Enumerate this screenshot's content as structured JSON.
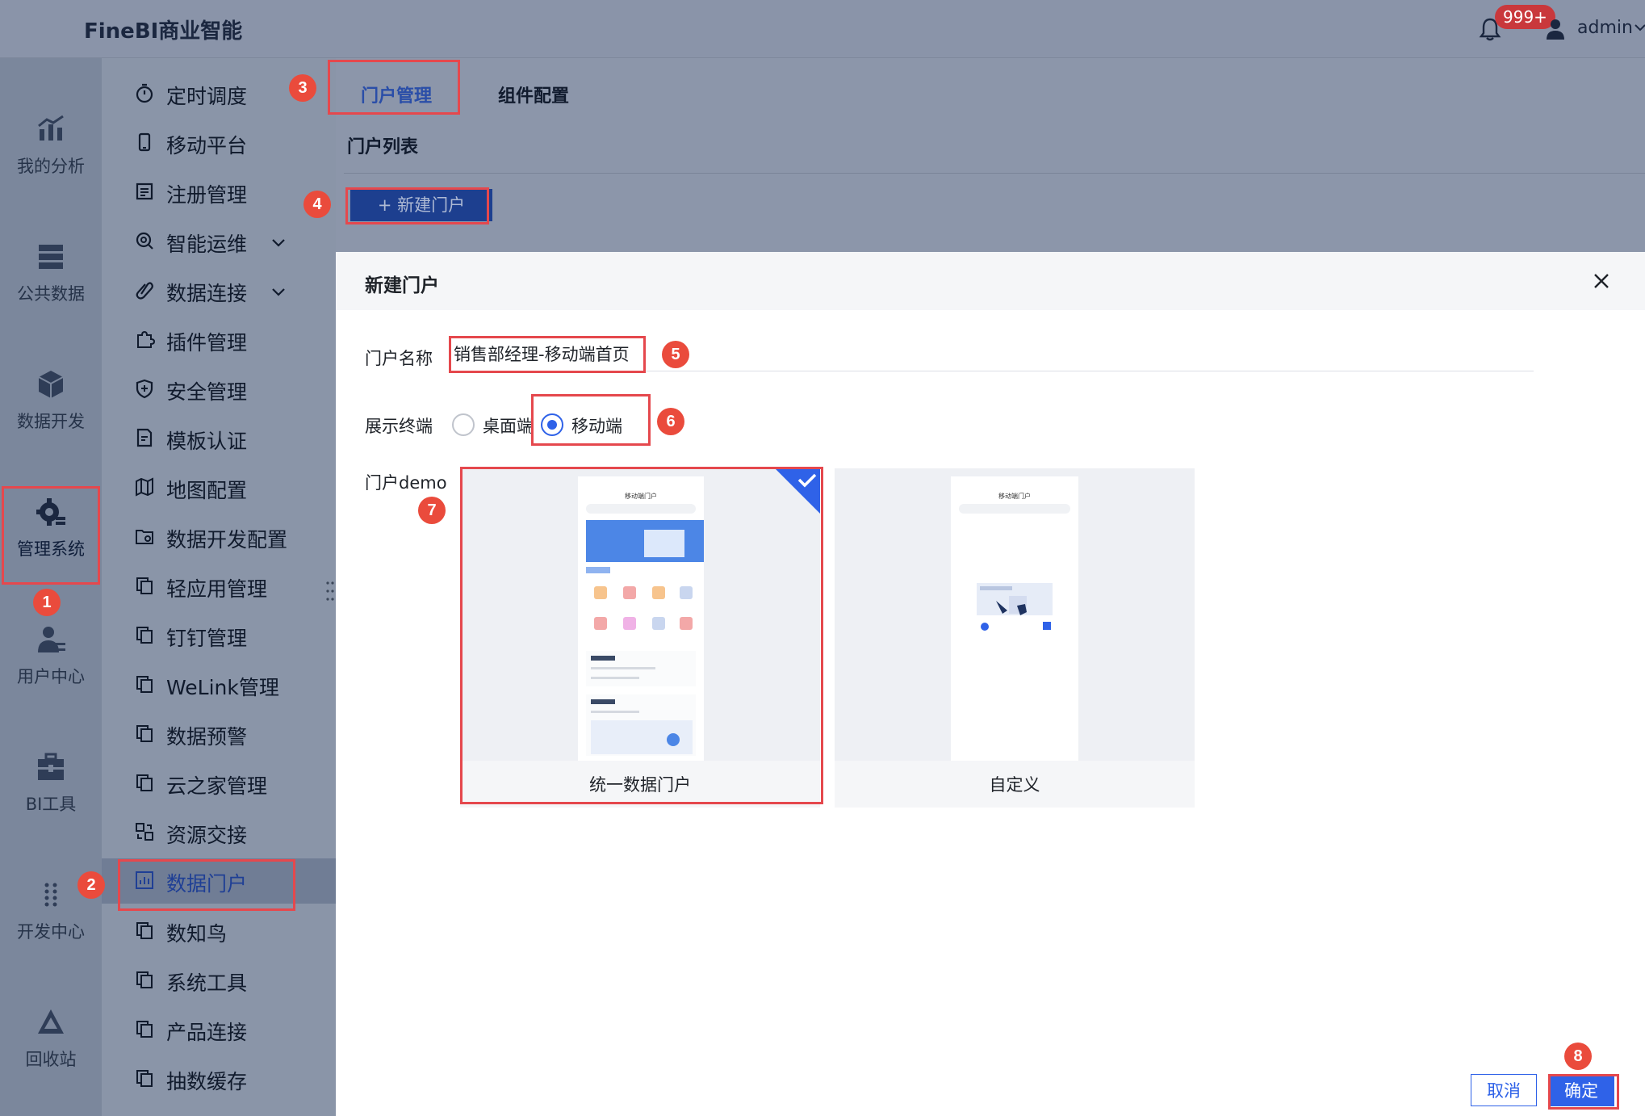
{
  "header": {
    "brand": "FineBI商业智能",
    "notification_count": "999+",
    "username": "admin"
  },
  "rail": {
    "items": [
      {
        "label": "我的分析",
        "icon": "analysis-chart-icon"
      },
      {
        "label": "公共数据",
        "icon": "public-data-icon"
      },
      {
        "label": "数据开发",
        "icon": "data-dev-cube-icon"
      },
      {
        "label": "管理系统",
        "icon": "gear-settings-icon",
        "active": true
      },
      {
        "label": "用户中心",
        "icon": "user-center-icon"
      },
      {
        "label": "BI工具",
        "icon": "toolbox-icon"
      },
      {
        "label": "开发中心",
        "icon": "dev-center-icon"
      },
      {
        "label": "回收站",
        "icon": "recycle-bin-icon"
      }
    ]
  },
  "menu": {
    "items": [
      {
        "label": "定时调度"
      },
      {
        "label": "移动平台"
      },
      {
        "label": "注册管理"
      },
      {
        "label": "智能运维",
        "expandable": true
      },
      {
        "label": "数据连接",
        "expandable": true
      },
      {
        "label": "插件管理"
      },
      {
        "label": "安全管理"
      },
      {
        "label": "模板认证"
      },
      {
        "label": "地图配置"
      },
      {
        "label": "数据开发配置"
      },
      {
        "label": "轻应用管理"
      },
      {
        "label": "钉钉管理"
      },
      {
        "label": "WeLink管理"
      },
      {
        "label": "数据预警"
      },
      {
        "label": "云之家管理"
      },
      {
        "label": "资源交接"
      },
      {
        "label": "数据门户",
        "active": true
      },
      {
        "label": "数知鸟"
      },
      {
        "label": "系统工具"
      },
      {
        "label": "产品连接"
      },
      {
        "label": "抽数缓存"
      }
    ]
  },
  "main": {
    "tabs": [
      {
        "label": "门户管理",
        "active": true
      },
      {
        "label": "组件配置"
      }
    ],
    "list_title": "门户列表",
    "new_button": "+ 新建门户"
  },
  "dialog": {
    "title": "新建门户",
    "name_label": "门户名称",
    "name_value": "销售部经理-移动端首页",
    "terminal_label": "展示终端",
    "terminal_options": [
      {
        "label": "桌面端",
        "checked": false
      },
      {
        "label": "移动端",
        "checked": true
      }
    ],
    "demo_label": "门户demo",
    "demos": [
      {
        "label": "统一数据门户",
        "selected": true,
        "preview_title": "移动端门户"
      },
      {
        "label": "自定义",
        "selected": false,
        "preview_title": "移动端门户"
      }
    ],
    "cancel": "取消",
    "confirm": "确定"
  },
  "steps": [
    "1",
    "2",
    "3",
    "4",
    "5",
    "6",
    "7",
    "8"
  ],
  "colors": {
    "accent": "#2f62e8",
    "annotation_red": "#e5484d",
    "step_badge": "#ea4b3c",
    "overlay_bg": "#8a95a8"
  }
}
